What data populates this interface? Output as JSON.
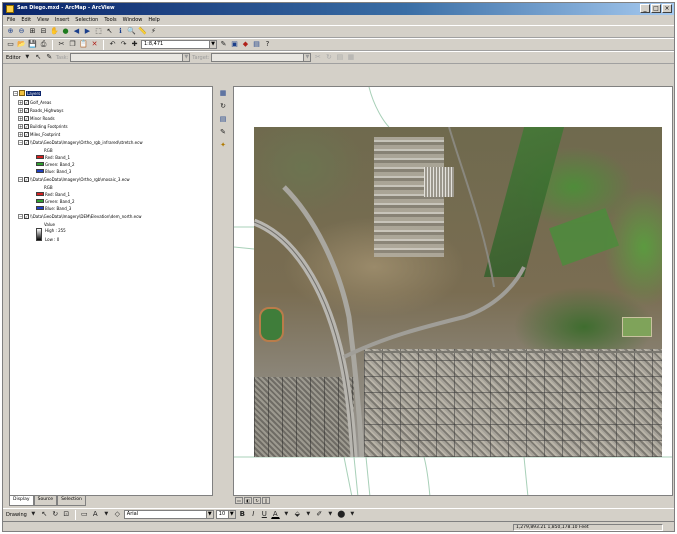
{
  "window": {
    "title": "San Diego.mxd - ArcMap - ArcView"
  },
  "menu": [
    "File",
    "Edit",
    "View",
    "Insert",
    "Selection",
    "Tools",
    "Window",
    "Help"
  ],
  "toolbar": {
    "scale_value": "1:8,471",
    "editor_label": "Editor",
    "task_label": "Task:",
    "target_label": "Target:"
  },
  "toc": {
    "root": "Layers",
    "layers": [
      {
        "name": "Golf_Areas",
        "checked": true
      },
      {
        "name": "Roads_Highways",
        "checked": true
      },
      {
        "name": "Minor Roads",
        "checked": true
      },
      {
        "name": "Building Footprints",
        "checked": true
      },
      {
        "name": "Miles_Footprint",
        "checked": true
      },
      {
        "name": "\\\\Data\\GeoData\\Imagery\\Ortho_rgb_infrared\\stretch.ecw",
        "checked": true,
        "legend_title": "RGB",
        "bands": [
          {
            "label": "Red: Band_1",
            "color": "#d42020"
          },
          {
            "label": "Green: Band_2",
            "color": "#30a030"
          },
          {
            "label": "Blue: Band_3",
            "color": "#2040c0"
          }
        ]
      },
      {
        "name": "\\\\Data\\GeoData\\Imagery\\Ortho_rgb\\mosaic_3.ecw",
        "checked": true,
        "legend_title": "RGB",
        "bands": [
          {
            "label": "Red: Band_1",
            "color": "#d42020"
          },
          {
            "label": "Green: Band_2",
            "color": "#30a030"
          },
          {
            "label": "Blue: Band_3",
            "color": "#2040c0"
          }
        ]
      },
      {
        "name": "\\\\Data\\GeoData\\Imagery\\DEM\\Elevation\\dem_north.ecw",
        "checked": true,
        "legend_title": "Value",
        "ramp": {
          "high": "High : 255",
          "low": "Low : 0"
        }
      }
    ],
    "tabs": [
      "Display",
      "Source",
      "Selection"
    ]
  },
  "drawing_bar": {
    "label": "Drawing",
    "font": "Arial",
    "font_size": "10"
  },
  "status": {
    "coords": "1,279,893.21  1,850,178.10 Feet"
  },
  "colors": {
    "title_gradient_start": "#0a246a",
    "chrome": "#d4d0c8"
  }
}
